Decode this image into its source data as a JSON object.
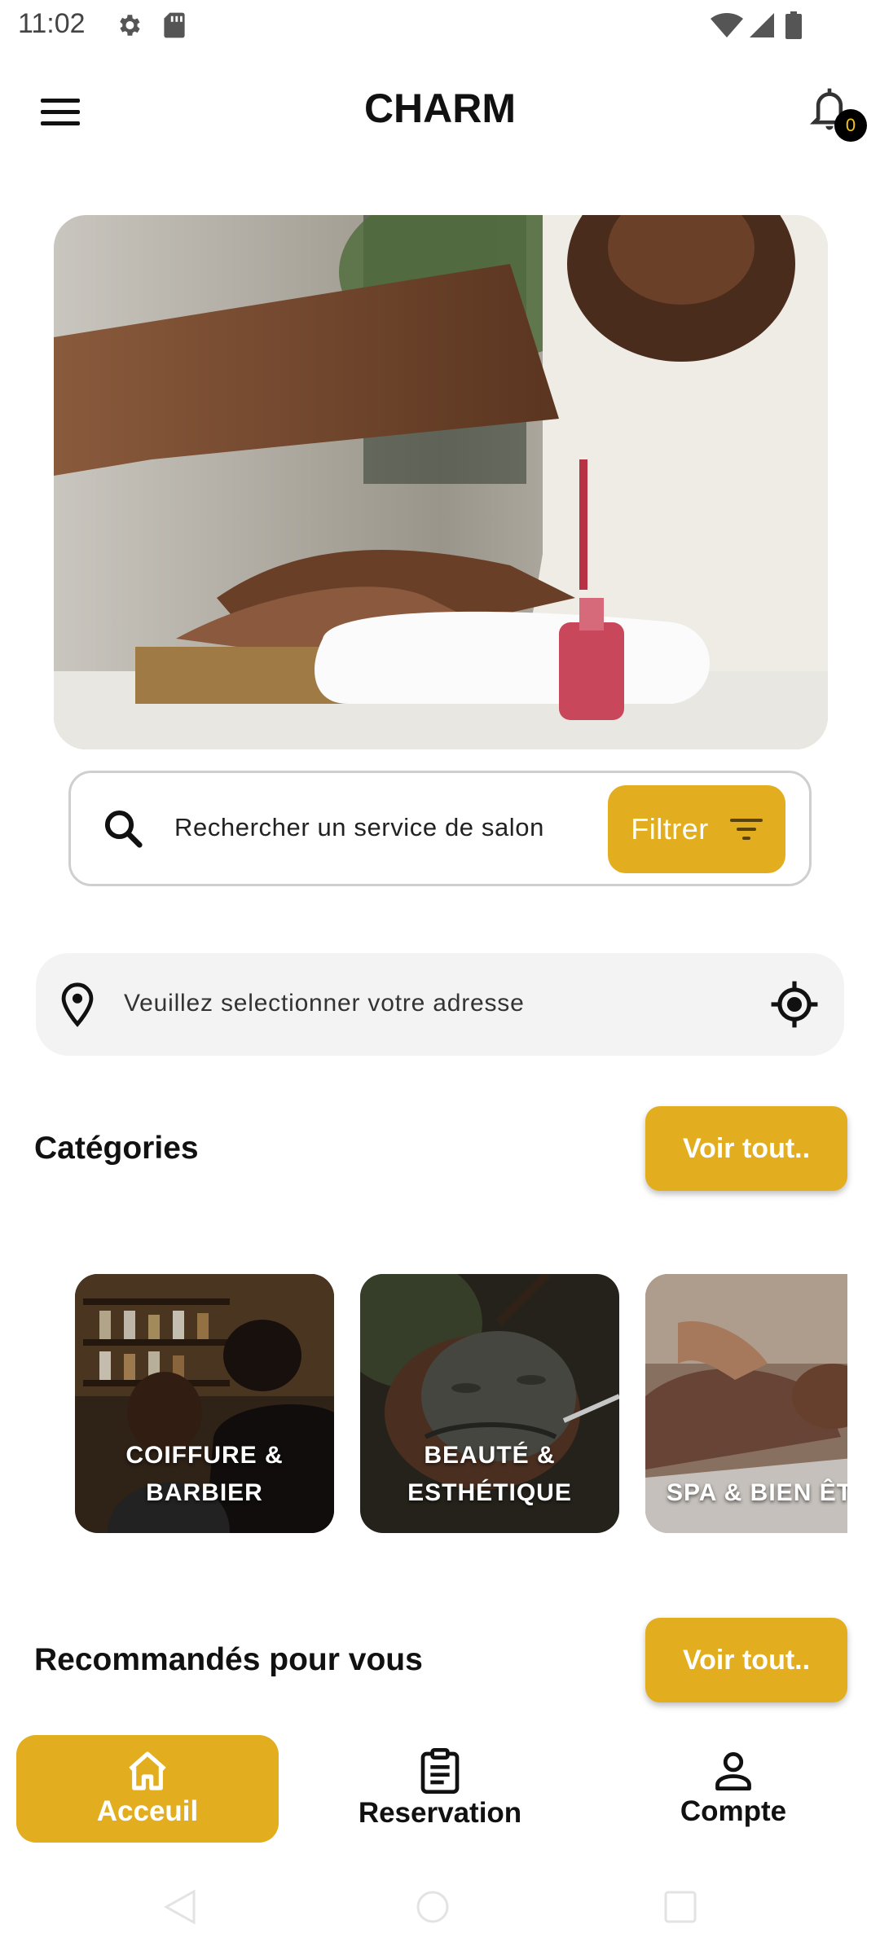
{
  "status_bar": {
    "time": "11:02"
  },
  "app_bar": {
    "title": "CHARM",
    "notification_count": "0"
  },
  "search": {
    "placeholder": "Rechercher un service de salon",
    "filter_label": "Filtrer"
  },
  "address": {
    "placeholder": "Veuillez selectionner votre adresse"
  },
  "categories": {
    "title": "Catégories",
    "see_all": "Voir tout..",
    "items": [
      {
        "line1": "COIFFURE &",
        "line2": "BARBIER"
      },
      {
        "line1": "BEAUTÉ &",
        "line2": "ESTHÉTIQUE"
      },
      {
        "line1": "",
        "line2": "SPA & BIEN ÊT"
      }
    ]
  },
  "recommended": {
    "title": "Recommandés pour vous",
    "see_all": "Voir tout.."
  },
  "bottom_nav": {
    "items": [
      {
        "label": "Acceuil",
        "icon": "home-icon",
        "active": true
      },
      {
        "label": "Reservation",
        "icon": "clipboard-icon",
        "active": false
      },
      {
        "label": "Compte",
        "icon": "person-icon",
        "active": false
      }
    ]
  },
  "colors": {
    "accent": "#E2AD1E",
    "badge_bg": "#000000",
    "badge_text": "#F3C316",
    "address_bg": "#F3F3F3"
  }
}
